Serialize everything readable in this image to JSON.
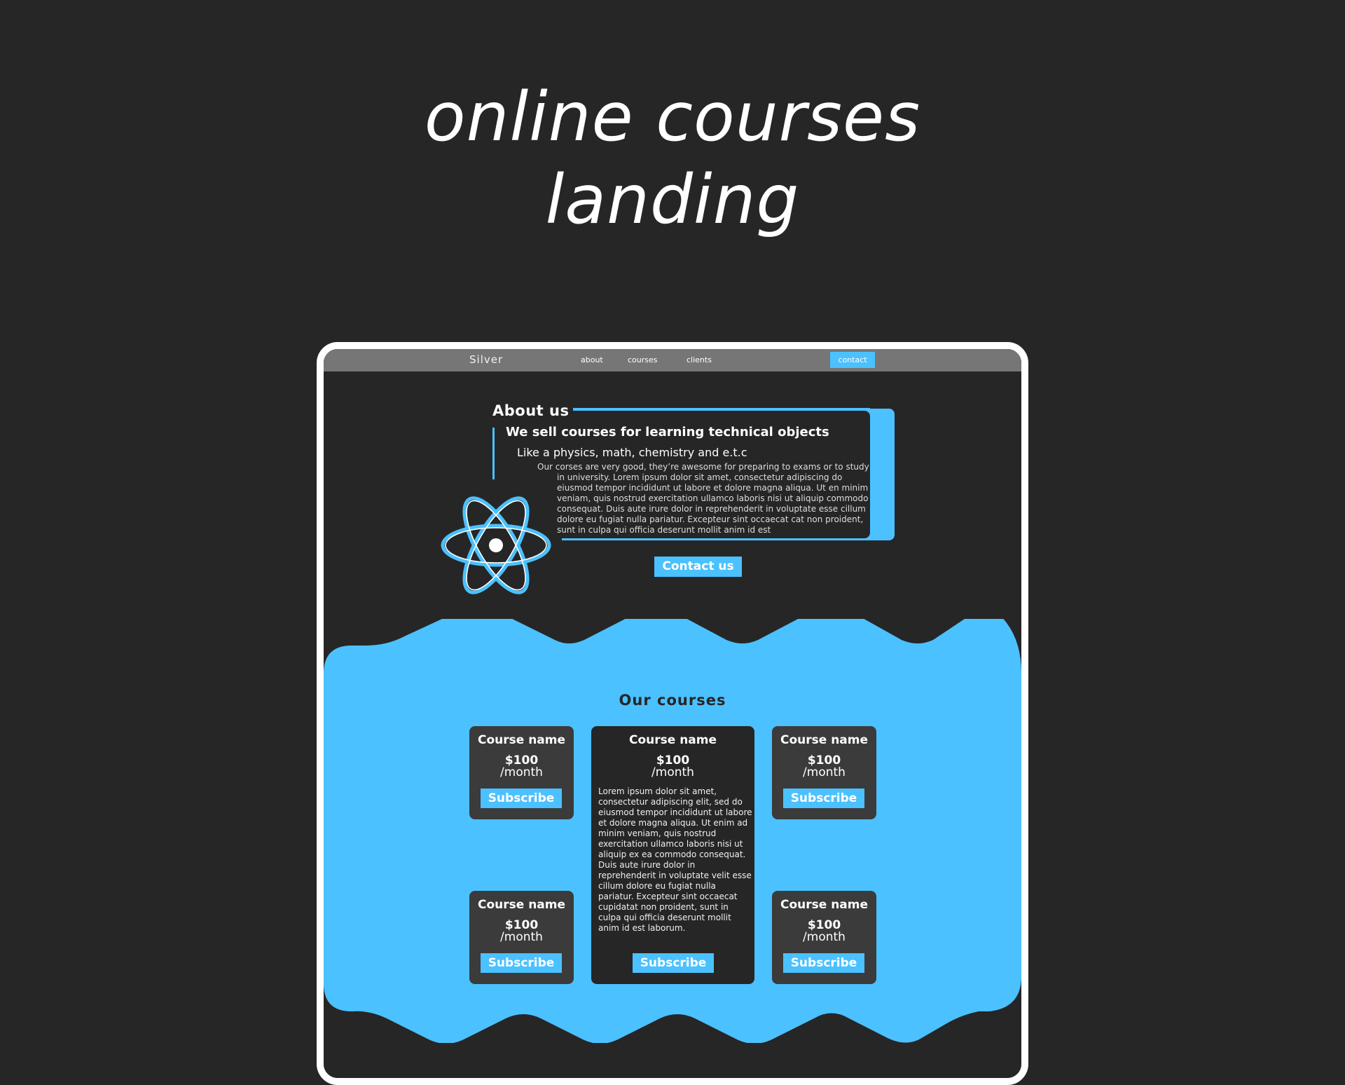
{
  "hero": {
    "line1": "online courses",
    "line2": "landing"
  },
  "nav": {
    "brand": "Silver",
    "links": [
      "about",
      "courses",
      "clients"
    ],
    "contact": "contact"
  },
  "about": {
    "title": "About us",
    "heading": "We sell courses for learning technical objects",
    "subheading": "Like a physics, math, chemistry and e.t.c",
    "paragraph": "Our corses are very good, they’re awesome for preparing to exams or to study in university. Lorem ipsum dolor sit amet, consectetur adipiscing do eiusmod tempor incididunt ut labore et dolore magna aliqua. Ut en minim veniam, quis nostrud exercitation ullamco laboris nisi ut aliquip commodo consequat. Duis aute irure dolor in reprehenderit in voluptate esse cillum dolore eu fugiat nulla pariatur. Excepteur sint occaecat cat non proident, sunt in culpa qui officia deserunt mollit anim id est",
    "contact_button": "Contact us"
  },
  "courses": {
    "title": "Our courses",
    "cards": [
      {
        "name": "Course name",
        "price": "$100",
        "period": "/month",
        "button": "Subscribe"
      },
      {
        "name": "Course name",
        "price": "$100",
        "period": "/month",
        "button": "Subscribe",
        "description": "Lorem ipsum dolor sit amet, consectetur adipiscing elit, sed do eiusmod tempor incididunt ut labore et dolore magna aliqua. Ut enim ad minim veniam, quis nostrud exercitation ullamco laboris nisi ut aliquip ex ea commodo consequat. Duis aute irure dolor in reprehenderit in voluptate velit esse cillum dolore eu fugiat nulla pariatur. Excepteur sint occaecat cupidatat non proident, sunt in culpa qui officia deserunt mollit anim id est laborum."
      },
      {
        "name": "Course name",
        "price": "$100",
        "period": "/month",
        "button": "Subscribe"
      },
      {
        "name": "Course name",
        "price": "$100",
        "period": "/month",
        "button": "Subscribe"
      },
      {
        "name": "Course name",
        "price": "$100",
        "period": "/month",
        "button": "Subscribe"
      }
    ]
  },
  "colors": {
    "accent": "#4bc1ff",
    "background": "#262626",
    "nav": "#767676",
    "card": "#3b3b3b"
  }
}
